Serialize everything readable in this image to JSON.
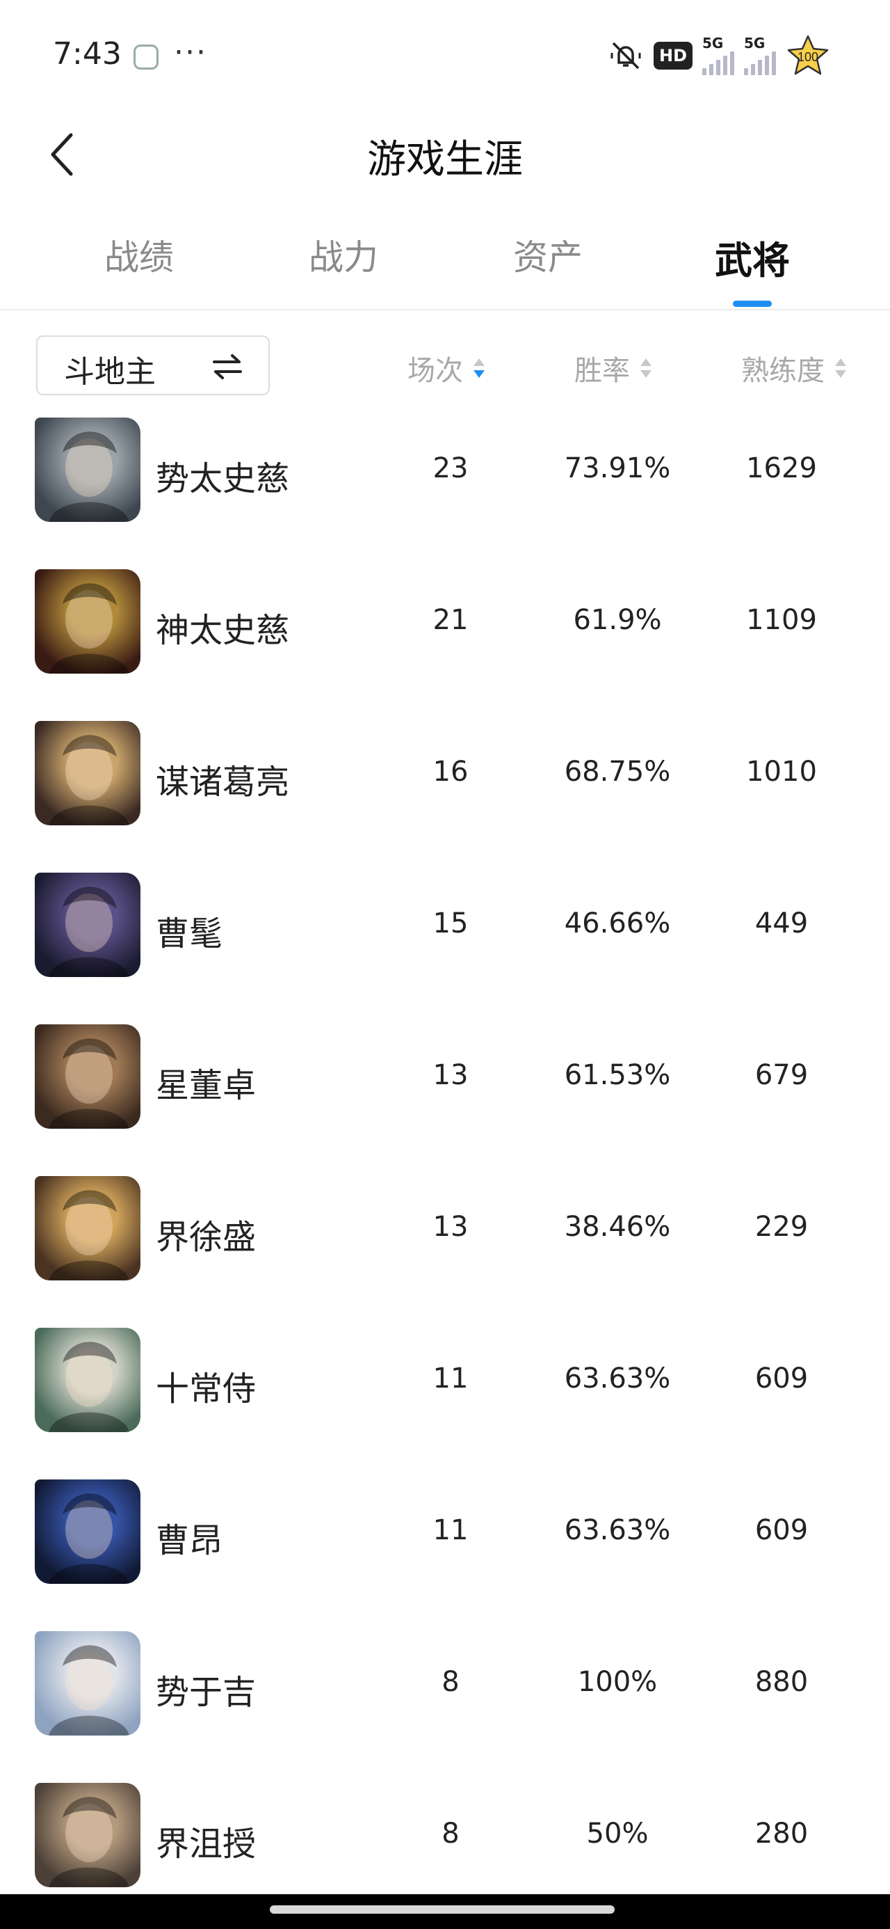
{
  "status_bar": {
    "time": "7:43",
    "more": "···",
    "hd": "HD",
    "sim1": "5G",
    "sim2": "5G",
    "badge": "100"
  },
  "header": {
    "title": "游戏生涯"
  },
  "tabs": [
    {
      "label": "战绩",
      "active": false
    },
    {
      "label": "战力",
      "active": false
    },
    {
      "label": "资产",
      "active": false
    },
    {
      "label": "武将",
      "active": true
    }
  ],
  "filter": {
    "mode": "斗地主"
  },
  "columns": {
    "games": "场次",
    "win_rate": "胜率",
    "proficiency": "熟练度"
  },
  "colors": {
    "accent": "#1e8ff0",
    "muted": "#a8a8a8"
  },
  "heroes": [
    {
      "name": "势太史慈",
      "games": "23",
      "win_rate": "73.91%",
      "proficiency": "1629",
      "avatar_palette": [
        "#9aa3a8",
        "#3e4650"
      ]
    },
    {
      "name": "神太史慈",
      "games": "21",
      "win_rate": "61.9%",
      "proficiency": "1109",
      "avatar_palette": [
        "#b08a3a",
        "#3a1b14"
      ]
    },
    {
      "name": "谋诸葛亮",
      "games": "16",
      "win_rate": "68.75%",
      "proficiency": "1010",
      "avatar_palette": [
        "#c9a46a",
        "#3b2a24"
      ]
    },
    {
      "name": "曹髦",
      "games": "15",
      "win_rate": "46.66%",
      "proficiency": "449",
      "avatar_palette": [
        "#5a4f86",
        "#1b1b30"
      ]
    },
    {
      "name": "星董卓",
      "games": "13",
      "win_rate": "61.53%",
      "proficiency": "679",
      "avatar_palette": [
        "#a07a55",
        "#3b2a20"
      ]
    },
    {
      "name": "界徐盛",
      "games": "13",
      "win_rate": "38.46%",
      "proficiency": "229",
      "avatar_palette": [
        "#d0a35a",
        "#4a3322"
      ]
    },
    {
      "name": "十常侍",
      "games": "11",
      "win_rate": "63.63%",
      "proficiency": "609",
      "avatar_palette": [
        "#cfd2c6",
        "#4a6b5a"
      ]
    },
    {
      "name": "曹昂",
      "games": "11",
      "win_rate": "63.63%",
      "proficiency": "609",
      "avatar_palette": [
        "#3553a5",
        "#111a35"
      ]
    },
    {
      "name": "势于吉",
      "games": "8",
      "win_rate": "100%",
      "proficiency": "880",
      "avatar_palette": [
        "#dfe3ea",
        "#8ea3c0"
      ]
    },
    {
      "name": "界沮授",
      "games": "8",
      "win_rate": "50%",
      "proficiency": "280",
      "avatar_palette": [
        "#b49a7d",
        "#4c4038"
      ]
    }
  ]
}
